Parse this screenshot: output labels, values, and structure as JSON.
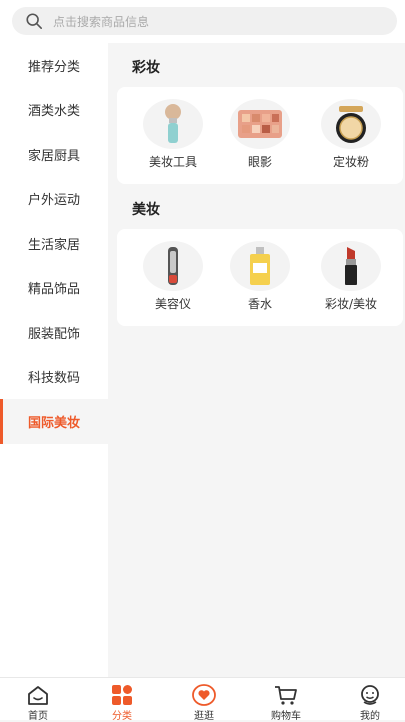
{
  "search": {
    "placeholder": "点击搜索商品信息"
  },
  "sidebar": {
    "items": [
      {
        "label": "推荐分类"
      },
      {
        "label": "酒类水类"
      },
      {
        "label": "家居厨具"
      },
      {
        "label": "户外运动"
      },
      {
        "label": "生活家居"
      },
      {
        "label": "精品饰品"
      },
      {
        "label": "服装配饰"
      },
      {
        "label": "科技数码"
      },
      {
        "label": "国际美妆"
      }
    ],
    "active": "国际美妆"
  },
  "sections": [
    {
      "title": "彩妆",
      "products": [
        {
          "label": "美妆工具",
          "icon": "makeup-brush-icon"
        },
        {
          "label": "眼影",
          "icon": "eyeshadow-palette-icon"
        },
        {
          "label": "定妆粉",
          "icon": "powder-compact-icon"
        }
      ]
    },
    {
      "title": "美妆",
      "products": [
        {
          "label": "美容仪",
          "icon": "beauty-device-icon"
        },
        {
          "label": "香水",
          "icon": "perfume-bottle-icon"
        },
        {
          "label": "彩妆/美妆",
          "icon": "lipstick-icon"
        }
      ]
    }
  ],
  "tabbar": {
    "items": [
      {
        "label": "首页",
        "icon": "home-icon"
      },
      {
        "label": "分类",
        "icon": "category-icon"
      },
      {
        "label": "逛逛",
        "icon": "browse-heart-icon"
      },
      {
        "label": "购物车",
        "icon": "cart-icon"
      },
      {
        "label": "我的",
        "icon": "profile-icon"
      }
    ],
    "active": "分类"
  },
  "colors": {
    "accent": "#ee5a2a",
    "background": "#f5f5f5",
    "card": "#ffffff"
  }
}
